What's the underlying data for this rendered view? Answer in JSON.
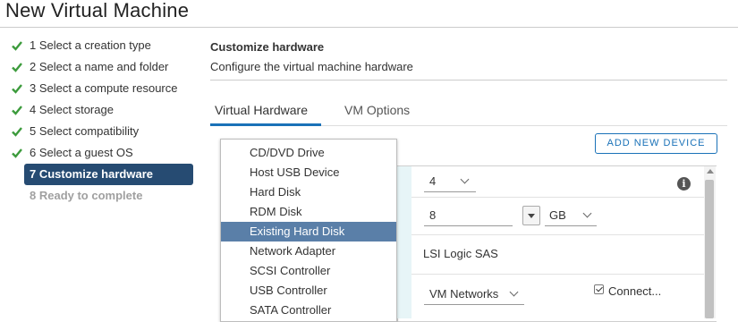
{
  "window": {
    "title": "New Virtual Machine"
  },
  "steps": [
    {
      "label": "1 Select a creation type",
      "state": "done"
    },
    {
      "label": "2 Select a name and folder",
      "state": "done"
    },
    {
      "label": "3 Select a compute resource",
      "state": "done"
    },
    {
      "label": "4 Select storage",
      "state": "done"
    },
    {
      "label": "5 Select compatibility",
      "state": "done"
    },
    {
      "label": "6 Select a guest OS",
      "state": "done"
    },
    {
      "label": "7 Customize hardware",
      "state": "active"
    },
    {
      "label": "8 Ready to complete",
      "state": "pending"
    }
  ],
  "section": {
    "title": "Customize hardware",
    "subtitle": "Configure the virtual machine hardware"
  },
  "tabs": [
    {
      "label": "Virtual Hardware",
      "active": true
    },
    {
      "label": "VM Options",
      "active": false
    }
  ],
  "add_device_label": "ADD NEW DEVICE",
  "hardware": {
    "cpu_value": "4",
    "memory_value": "8",
    "memory_unit": "GB",
    "scsi_type": "LSI Logic SAS",
    "network_value": "VM Networks",
    "connect_label": "Connect...",
    "connect_checked": true
  },
  "add_device_menu": {
    "items": [
      "CD/DVD Drive",
      "Host USB Device",
      "Hard Disk",
      "RDM Disk",
      "Existing Hard Disk",
      "Network Adapter",
      "SCSI Controller",
      "USB Controller",
      "SATA Controller"
    ],
    "highlighted": "Existing Hard Disk"
  },
  "colors": {
    "accent": "#1a72b8",
    "active_step_bg": "#264b72",
    "menu_highlight": "#5a7fa8",
    "check_green": "#3c9b3c"
  },
  "icons": {
    "step_done": "check-icon",
    "info": "info-icon"
  }
}
